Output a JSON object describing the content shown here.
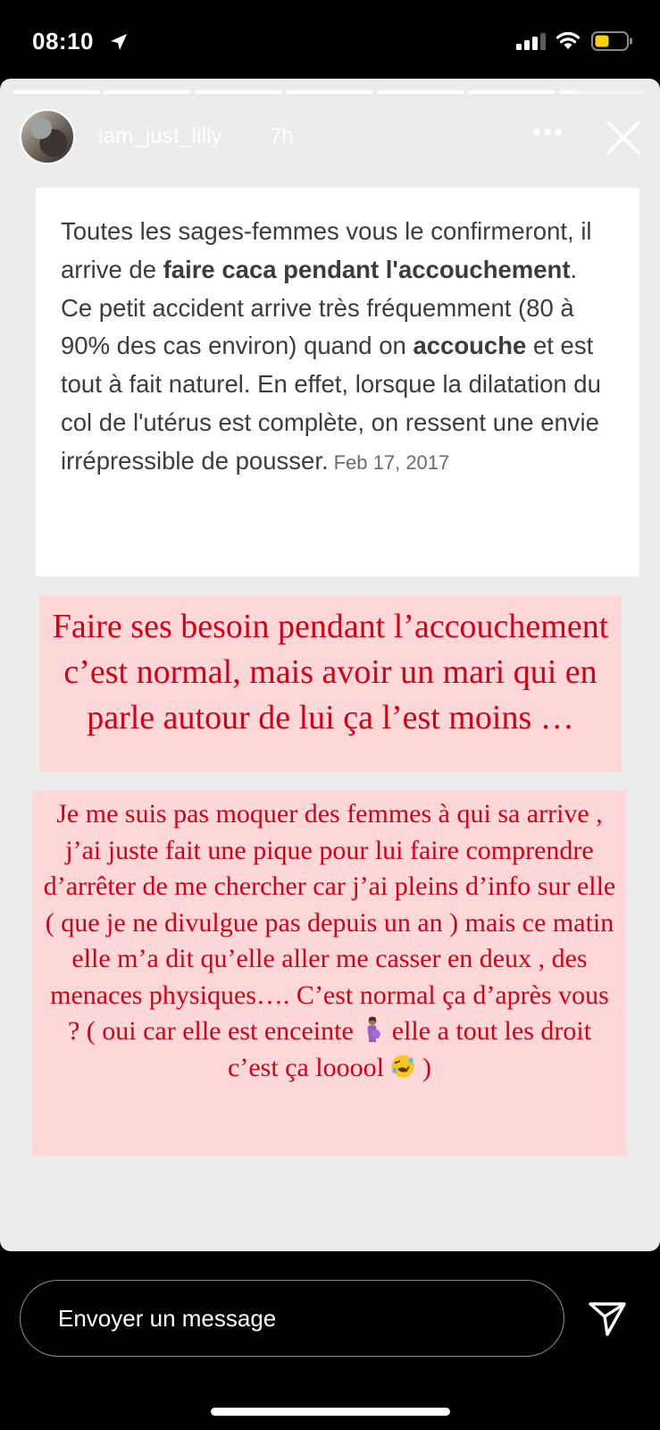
{
  "status_bar": {
    "time": "08:10",
    "icons": [
      "location-arrow-icon",
      "cellular-signal-icon",
      "wifi-icon",
      "battery-icon"
    ],
    "battery_color": "#f7d30f"
  },
  "story": {
    "progress": {
      "segments": 7,
      "current_segment": 7,
      "current_fraction": 0.2
    },
    "username": "iam_just_lilly",
    "time_ago": "7h",
    "more_label": "•••",
    "icons": {
      "more": "more-icon",
      "close": "close-icon"
    },
    "screenshot": {
      "p1": "Toutes les sages-femmes vous le confirmeront, il arrive de ",
      "b1": "faire caca pendant l'accouchement",
      "p2": ". Ce petit accident arrive très fréquemment (80 à 90% des cas environ) quand on ",
      "b2": "accouche",
      "p3": " et est tout à fait naturel. En effet, lorsque la dilatation du col de l'utérus est complète, on ressent une envie irrépressible de pousser.",
      "date": "Feb 17, 2017"
    },
    "caption_1": "Faire ses besoin pendant l’accouchement c’est normal, mais avoir  un mari qui en parle autour de lui ça l’est moins …",
    "caption_2_before_emoji": "Je me suis pas moquer des femmes à qui sa arrive , j’ai juste fait une pique pour lui faire comprendre d’arrêter de me chercher car j’ai pleins d’info sur elle ( que je ne divulgue pas depuis un an ) mais ce matin elle m’a dit qu’elle aller me casser en deux , des menaces physiques…. C’est normal ça d’après vous ? ( oui car elle est enceinte",
    "caption_2_middle": "elle a tout les droit c’est ça looool",
    "caption_2_end": ")",
    "emojis": [
      "pregnant-woman-emoji",
      "rolling-laughing-emoji"
    ],
    "colors": {
      "caption_text": "#d40016",
      "caption_bg": "#fed8d8",
      "story_bg": "#ececec"
    }
  },
  "reply_bar": {
    "placeholder": "Envoyer un message",
    "send_icon": "send-icon"
  }
}
